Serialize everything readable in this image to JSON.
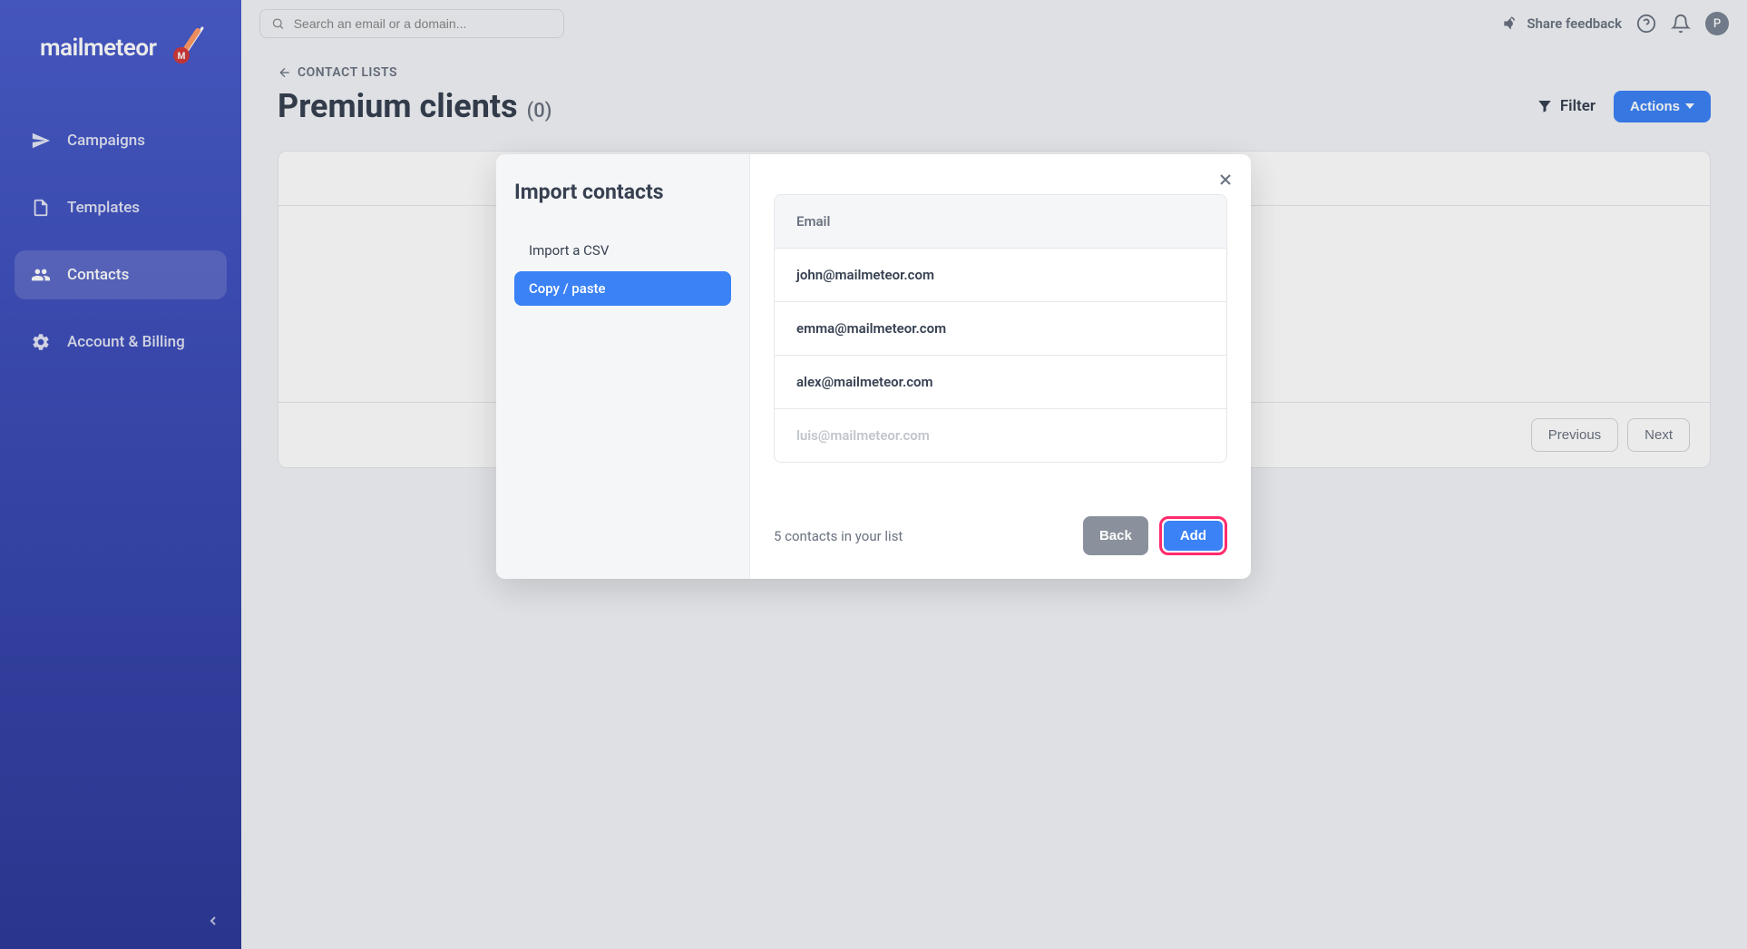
{
  "brand": {
    "name": "mailmeteor"
  },
  "sidebar": {
    "items": [
      {
        "label": "Campaigns"
      },
      {
        "label": "Templates"
      },
      {
        "label": "Contacts"
      },
      {
        "label": "Account & Billing"
      }
    ]
  },
  "topbar": {
    "search_placeholder": "Search an email or a domain...",
    "feedback_label": "Share feedback",
    "avatar_initial": "P"
  },
  "breadcrumb": {
    "label": "CONTACT LISTS"
  },
  "page": {
    "title": "Premium clients",
    "count": "(0)",
    "filter_label": "Filter",
    "actions_label": "Actions"
  },
  "pager": {
    "previous": "Previous",
    "next": "Next"
  },
  "modal": {
    "title": "Import contacts",
    "tabs": [
      {
        "label": "Import a CSV"
      },
      {
        "label": "Copy / paste"
      }
    ],
    "table_header": "Email",
    "emails": [
      "john@mailmeteor.com",
      "emma@mailmeteor.com",
      "alex@mailmeteor.com",
      "luis@mailmeteor.com"
    ],
    "count_text": "5 contacts in your list",
    "back_label": "Back",
    "add_label": "Add"
  }
}
